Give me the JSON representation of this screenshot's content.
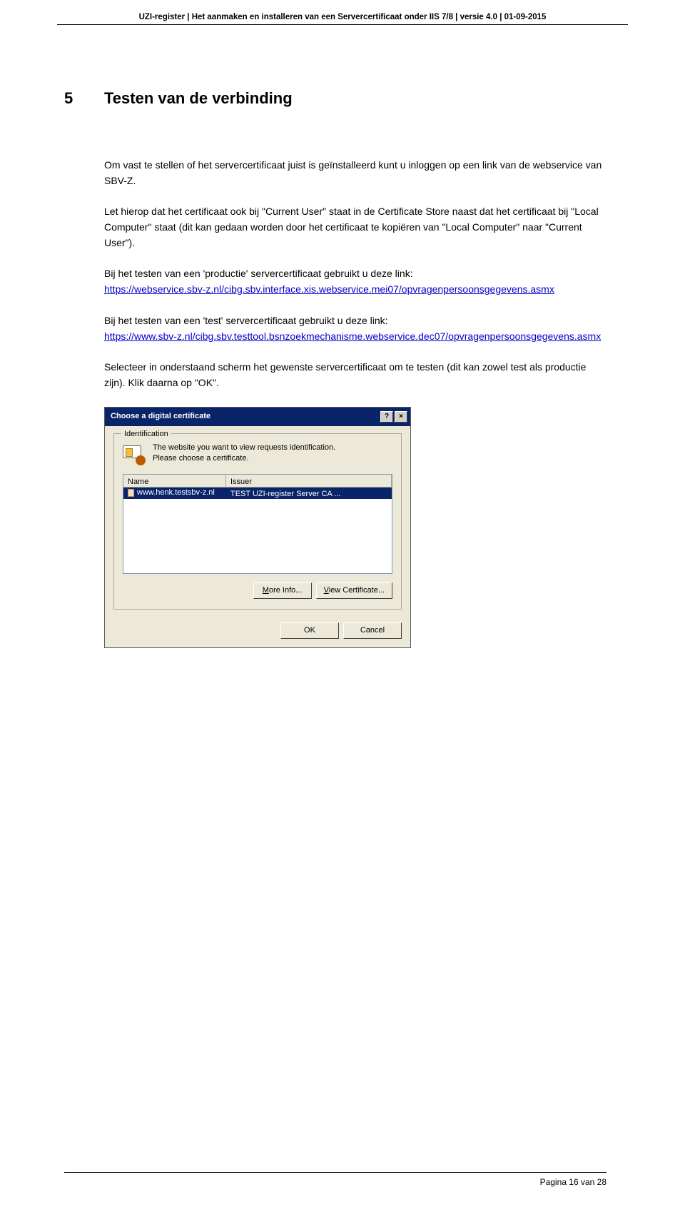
{
  "header": "UZI-register | Het aanmaken en installeren van een Servercertificaat onder IIS 7/8 | versie 4.0 | 01-09-2015",
  "section": {
    "num": "5",
    "title": "Testen van de verbinding"
  },
  "para1": "Om vast te stellen of het servercertificaat juist is geïnstalleerd kunt u inloggen op een link van de webservice van SBV-Z.",
  "para2": "Let hierop dat het certificaat ook bij \"Current User\" staat in de Certificate Store naast dat het certificaat bij \"Local Computer\" staat (dit kan gedaan worden door het certificaat te kopiëren van \"Local Computer\" naar \"Current User\").",
  "para3_lead": "Bij het testen van een 'productie' servercertificaat gebruikt u deze link:",
  "link1": "https://webservice.sbv-z.nl/cibg.sbv.interface.xis.webservice.mei07/opvragenpersoonsgegevens.asmx",
  "para4_lead": "Bij het testen van een 'test' servercertificaat gebruikt u deze link:",
  "link2": "https://www.sbv-z.nl/cibg.sbv.testtool.bsnzoekmechanisme.webservice.dec07/opvragenpersoonsgegevens.asmx",
  "para5": "Selecteer in onderstaand scherm het gewenste servercertificaat om te testen (dit kan zowel test als productie zijn). Klik daarna op \"OK\".",
  "dialog": {
    "title": "Choose a digital certificate",
    "help_label": "?",
    "close_label": "×",
    "legend": "Identification",
    "ident_line1": "The website you want to view requests identification.",
    "ident_line2": "Please choose a certificate.",
    "columns": {
      "name": "Name",
      "issuer": "Issuer"
    },
    "row": {
      "name": "www.henk.testsbv-z.nl",
      "issuer": "TEST UZI-register Server CA ..."
    },
    "buttons": {
      "more_info": "More Info...",
      "view_cert": "View Certificate...",
      "ok": "OK",
      "cancel": "Cancel"
    }
  },
  "footer": "Pagina 16 van 28"
}
